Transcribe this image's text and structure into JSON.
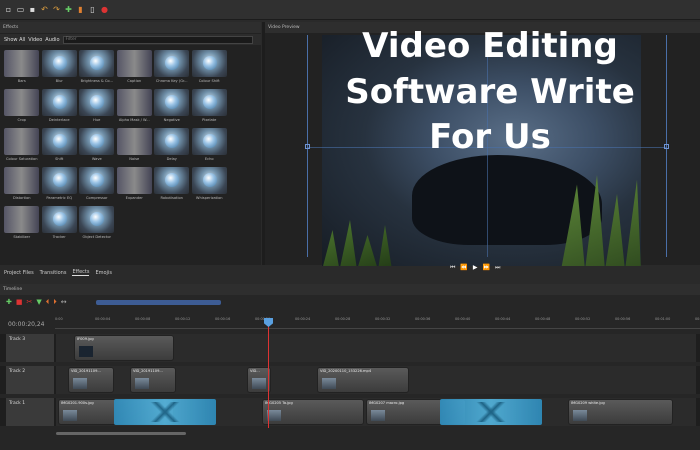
{
  "app": {
    "toolbar_icons": [
      "new-file-icon",
      "open-folder-icon",
      "save-icon",
      "undo-icon",
      "redo-icon",
      "add-icon",
      "import-icon",
      "export-icon",
      "record-icon"
    ]
  },
  "overlay": {
    "line1": "Video Editing",
    "line2": "Software Write",
    "line3": "For Us"
  },
  "effects": {
    "title": "Effects",
    "filter_tabs": [
      "Show All",
      "Video",
      "Audio"
    ],
    "filter_placeholder": "Filter",
    "items": [
      "Bars",
      "Blur",
      "Brightness & Co...",
      "Caption",
      "Chroma Key (Gr...",
      "Colour Shift",
      "Crop",
      "Deinterlace",
      "Hue",
      "Alpha Mask / W...",
      "Negative",
      "Pixelate",
      "Colour Saturation",
      "Shift",
      "Wave",
      "Noise",
      "Delay",
      "Echo",
      "Distortion",
      "Parametric EQ",
      "Compressor",
      "Expander",
      "Robotisation",
      "Whisperization",
      "Stabilizer",
      "Tracker",
      "Object Detector"
    ]
  },
  "preview": {
    "title": "Video Preview"
  },
  "bottom_tabs": [
    "Project Files",
    "Transitions",
    "Effects",
    "Emojis"
  ],
  "timeline": {
    "title": "Timeline",
    "timecode": "00:00:20,24",
    "ruler": [
      "0:00",
      "00:00:04",
      "00:00:08",
      "00:00:12",
      "00:00:16",
      "00:00:20",
      "00:00:24",
      "00:00:28",
      "00:00:32",
      "00:00:36",
      "00:00:40",
      "00:00:44",
      "00:00:48",
      "00:00:52",
      "00:00:56",
      "00:01:00",
      "00:01:04"
    ],
    "tracks": [
      {
        "label": "Track 3",
        "clips": [
          "IF009.jpg"
        ]
      },
      {
        "label": "Track 2",
        "clips": [
          "VID_20191109...",
          "VID_20191109...",
          "VID...",
          "VID_20200110_153226.mp4"
        ]
      },
      {
        "label": "Track 1",
        "clips": [
          "IMG0201.900s.jpg",
          "IMG0205 Ta.jpg",
          "IMG0207 macro.jpg",
          "IMG0209 white.jpg"
        ]
      }
    ]
  }
}
